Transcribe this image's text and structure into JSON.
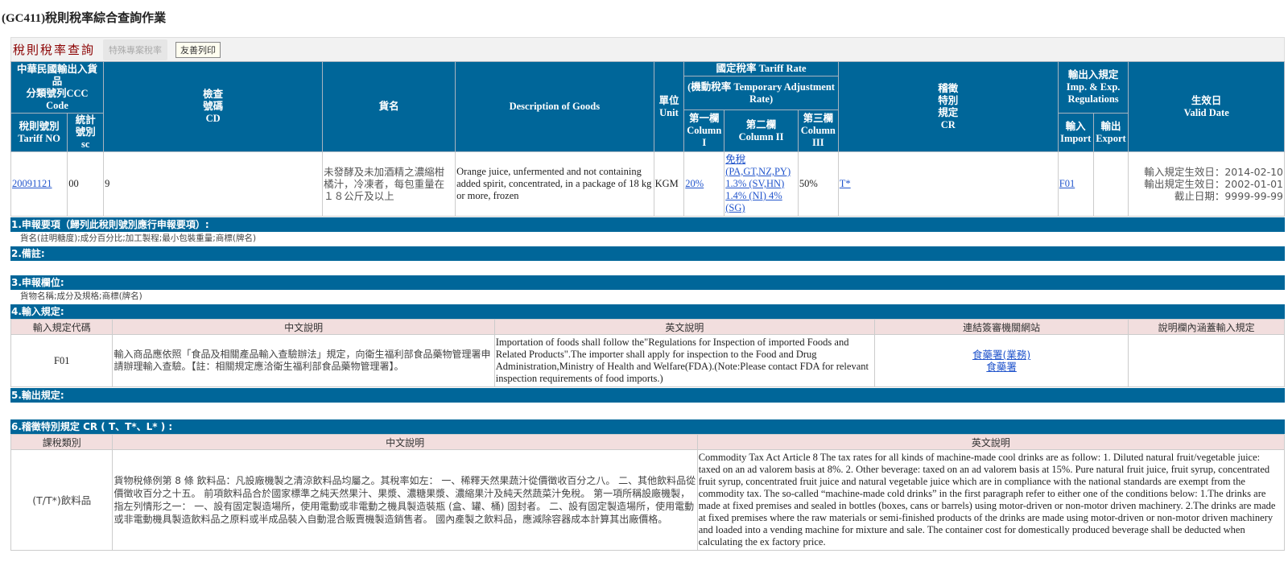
{
  "page_title": "(GC411)稅則稅率綜合查詢作業",
  "toolbar": {
    "heading": "稅則稅率查詢",
    "special_rate_button": "特殊專案稅率",
    "print_button": "友善列印"
  },
  "main_table": {
    "headers": {
      "ccc_code": [
        "中華民國輸出入貨品",
        "分類號列CCC",
        "Code"
      ],
      "tariff_no": [
        "稅則號別",
        "Tariff NO"
      ],
      "sc": [
        "統計",
        "號別",
        "sc"
      ],
      "cd": [
        "檢查",
        "號碼",
        "CD"
      ],
      "goods_name": "貨名",
      "description": "Description of Goods",
      "unit": [
        "單位",
        "Unit"
      ],
      "tariff_rate": "國定稅率 Tariff Rate",
      "temp_rate": "(機動稅率 Temporary Adjustment Rate)",
      "col1": [
        "第一欄",
        "Column",
        "I"
      ],
      "col2": [
        "第二欄",
        "Column II"
      ],
      "col3": [
        "第三欄",
        "Column",
        "III"
      ],
      "cr": [
        "稽徵",
        "特別",
        "規定",
        "CR"
      ],
      "regs": [
        "輸出入規定",
        "Imp. & Exp.",
        "Regulations"
      ],
      "import": [
        "輸入",
        "Import"
      ],
      "export": [
        "輸出",
        "Export"
      ],
      "valid_date": [
        "生效日",
        "Valid Date"
      ]
    },
    "row": {
      "tariff_no": "20091121",
      "sc": "00",
      "cd": "9",
      "goods_name": "未發酵及未加酒精之濃縮柑橘汁，冷凍者，每包重量在１８公斤及以上",
      "description": "Orange juice, unfermented and not containing added spirit, concentrated, in a package of 18 kg or more, frozen",
      "unit": "KGM",
      "col1": "20%",
      "col2": "免稅 (PA,GT,NZ,PY) 1.3% (SV,HN) 1.4% (NI) 4% (SG)",
      "col3": "50%",
      "cr": "T*",
      "import": "F01",
      "export": "",
      "valid_dates": [
        "輸入規定生效日：2014-02-10",
        "輸出規定生效日：2002-01-01",
        "截止日期：9999-99-99"
      ]
    }
  },
  "sections": {
    "s1": {
      "title": "1.申報要項（歸列此稅則號別應行申報要項）:",
      "body": "貨名(註明糖度);成分百分比;加工製程;最小包裝重量;商標(牌名)"
    },
    "s2": {
      "title": "2.備註:",
      "body": ""
    },
    "s3": {
      "title": "3.申報欄位:",
      "body": "貨物名稱;成分及規格;商標(牌名)"
    },
    "s4": {
      "title": "4.輸入規定:",
      "columns": [
        "輸入規定代碼",
        "中文說明",
        "英文說明",
        "連結簽審機關網站",
        "說明欄內涵蓋輸入規定"
      ],
      "rows": [
        {
          "code": "F01",
          "zh": "輸入商品應依照「食品及相關產品輸入查驗辦法」規定，向衛生福利部食品藥物管理署申請辦理輸入查驗。【註：相關規定應洽衛生福利部食品藥物管理署】。",
          "en": "Importation of foods shall follow the\"Regulations for Inspection of imported Foods and Related Products\".The importer shall apply for inspection to the Food and Drug Administration,Ministry of Health and Welfare(FDA).(Note:Please contact FDA for relevant inspection requirements of food imports.)",
          "links": [
            "食藥署(業務)",
            "食藥署"
          ],
          "covered": ""
        }
      ]
    },
    "s5": {
      "title": "5.輸出規定:",
      "body": ""
    },
    "s6": {
      "title": "6.稽徵特別規定 CR ( T、T*、L* ) :",
      "columns": [
        "課稅類別",
        "中文說明",
        "英文說明"
      ],
      "rows": [
        {
          "category": "(T/T*)飲料品",
          "zh": "貨物稅條例第 8 條 飲料品：凡設廠機製之清涼飲料品均屬之。其稅率如左： 一、稀釋天然果蔬汁從價徵收百分之八。 二、其他飲料品從價徵收百分之十五。 前項飲料品合於國家標準之純天然果汁、果漿、濃糖果漿、濃縮果汁及純天然蔬菜汁免稅。 第一項所稱設廠機製，指左列情形之一： 一、設有固定製造場所，使用電動或非電動之機具製造裝瓶 (盒、罐、桶) 固封者。 二、設有固定製造場所，使用電動或非電動機具製造飲料品之原料或半成品裝入自動混合販賣機製造銷售者。 國內產製之飲料品，應減除容器成本計算其出廠價格。",
          "en": "Commodity Tax Act Article 8 The tax rates for all kinds of machine-made cool drinks are as follow: 1. Diluted natural fruit/vegetable juice: taxed on an ad valorem basis at 8%. 2. Other beverage: taxed on an ad valorem basis at 15%. Pure natural fruit juice, fruit syrup, concentrated fruit syrup, concentrated fruit juice and natural vegetable juice which are in compliance with the national standards are exempt from the commodity tax. The so-called “machine-made cold drinks” in the first paragraph refer to either one of the conditions below: 1.The drinks are made at fixed premises and sealed in bottles (boxes, cans or barrels) using motor-driven or non-motor driven machinery. 2.The drinks are made at fixed premises where the raw materials or semi-finished products of the drinks are made using motor-driven or non-motor driven machinery and loaded into a vending machine for mixture and sale. The container cost for domestically produced beverage shall be deducted when calculating the ex factory price."
        }
      ]
    }
  }
}
